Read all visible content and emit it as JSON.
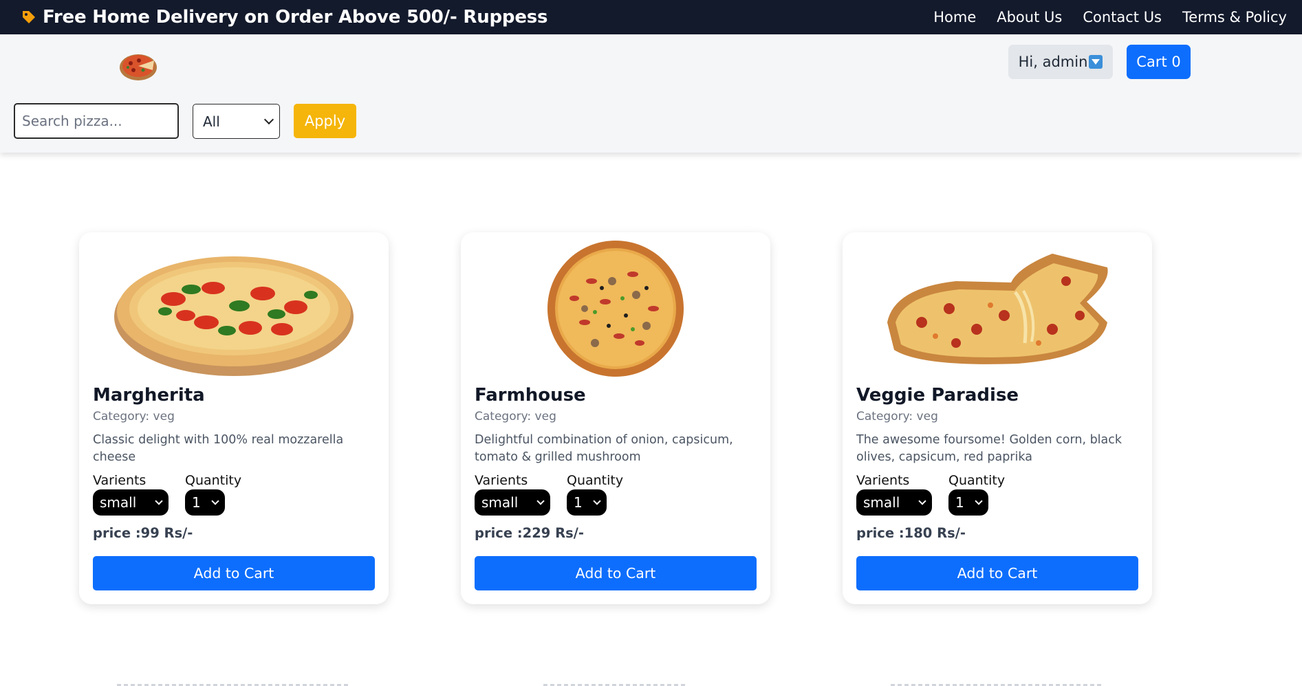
{
  "banner": {
    "promo_text": "Free Home Delivery on Order Above 500/- Ruppess",
    "promo_icon": "tag-icon",
    "nav": [
      "Home",
      "About Us",
      "Contact Us",
      "Terms & Policy"
    ]
  },
  "header": {
    "logo_icon": "pizza-logo",
    "user_label": "Hi, admin",
    "cart_label": "Cart 0",
    "search_placeholder": "Search pizza...",
    "category_selected": "All",
    "apply_label": "Apply"
  },
  "colors": {
    "banner_bg": "#131a2c",
    "primary": "#0d6efd",
    "apply": "#f5b50a"
  },
  "products": [
    {
      "name": "Margherita",
      "category": "Category: veg",
      "description": "Classic delight with 100% real mozzarella cheese",
      "variants_label": "Varients",
      "quantity_label": "Quantity",
      "variant": "small",
      "quantity": "1",
      "price": "price :99 Rs/-",
      "button": "Add to Cart"
    },
    {
      "name": "Farmhouse",
      "category": "Category: veg",
      "description": "Delightful combination of onion, capsicum, tomato & grilled mushroom",
      "variants_label": "Varients",
      "quantity_label": "Quantity",
      "variant": "small",
      "quantity": "1",
      "price": "price :229 Rs/-",
      "button": "Add to Cart"
    },
    {
      "name": "Veggie Paradise",
      "category": "Category: veg",
      "description": "The awesome foursome! Golden corn, black olives, capsicum, red paprika",
      "variants_label": "Varients",
      "quantity_label": "Quantity",
      "variant": "small",
      "quantity": "1",
      "price": "price :180 Rs/-",
      "button": "Add to Cart"
    }
  ]
}
